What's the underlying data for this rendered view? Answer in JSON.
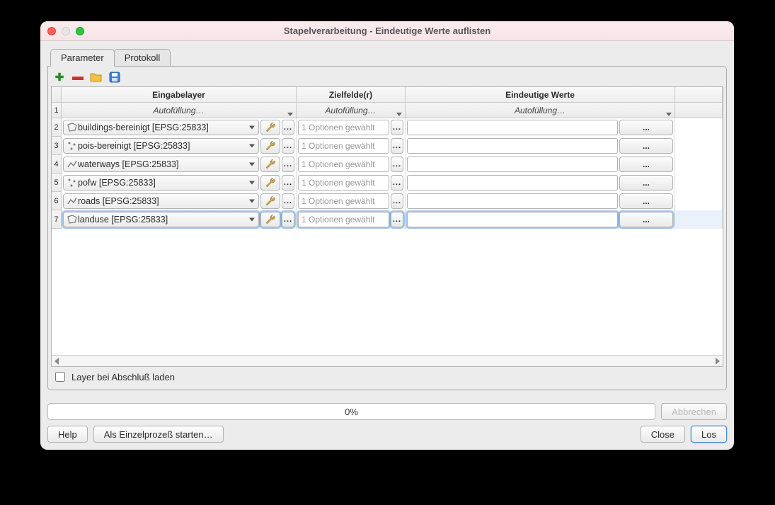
{
  "window": {
    "title": "Stapelverarbeitung - Eindeutige Werte auflisten"
  },
  "tabs": {
    "parameter": "Parameter",
    "protokoll": "Protokoll"
  },
  "headers": {
    "layer": "Eingabelayer",
    "target": "Zielfelde(r)",
    "unique": "Eindeutige Werte",
    "autofill": "Autofüllung…"
  },
  "rows": [
    {
      "idx": "2",
      "icon": "polygon",
      "label": "buildings-bereinigt [EPSG:25833]",
      "opt": "1 Optionen gewählt",
      "selected": false
    },
    {
      "idx": "3",
      "icon": "point",
      "label": "pois-bereinigt [EPSG:25833]",
      "opt": "1 Optionen gewählt",
      "selected": false
    },
    {
      "idx": "4",
      "icon": "line",
      "label": "waterways [EPSG:25833]",
      "opt": "1 Optionen gewählt",
      "selected": false
    },
    {
      "idx": "5",
      "icon": "point",
      "label": "pofw [EPSG:25833]",
      "opt": "1 Optionen gewählt",
      "selected": false
    },
    {
      "idx": "6",
      "icon": "line",
      "label": "roads [EPSG:25833]",
      "opt": "1 Optionen gewählt",
      "selected": false
    },
    {
      "idx": "7",
      "icon": "polygon",
      "label": "landuse [EPSG:25833]",
      "opt": "1 Optionen gewählt",
      "selected": true
    }
  ],
  "autofill_row_index": "1",
  "checkbox": {
    "label": "Layer bei Abschluß laden"
  },
  "progress": {
    "text": "0%"
  },
  "buttons": {
    "abort": "Abbrechen",
    "help": "Help",
    "single": "Als Einzelprozeß starten…",
    "close": "Close",
    "run": "Los"
  },
  "dots": "..."
}
